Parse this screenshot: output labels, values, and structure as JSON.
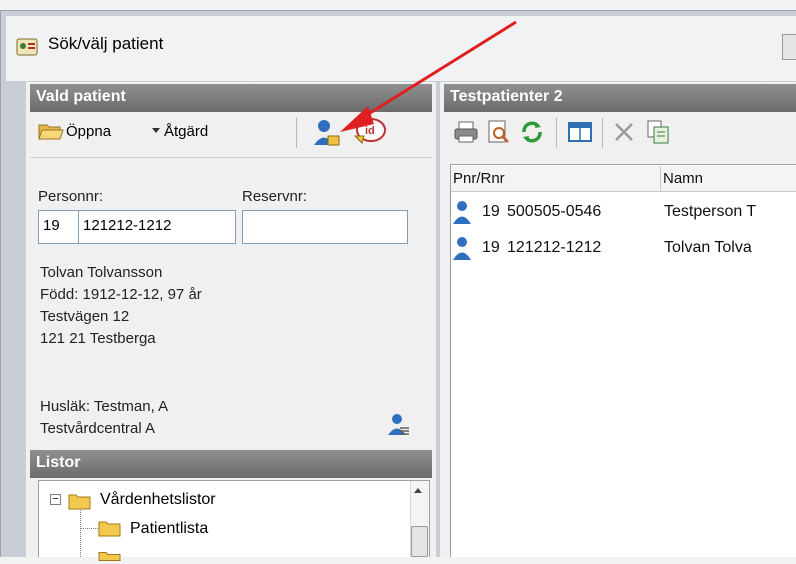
{
  "window": {
    "title": "Sök/välj patient"
  },
  "left_panel": {
    "header": "Vald patient",
    "toolbar": {
      "open_label": "Öppna",
      "action_label": "Åtgärd"
    },
    "personnr_label": "Personnr:",
    "reservnr_label": "Reservnr:",
    "personnr_prefix": "19",
    "personnr_value": "121212-1212",
    "reservnr_value": "",
    "patient_info": [
      "Tolvan Tolvansson",
      "Född: 1912-12-12, 97 år",
      "Testvägen 12",
      "121 21 Testberga"
    ],
    "gp_info": [
      "Husläk: Testman, A",
      "Testvårdcentral A"
    ]
  },
  "lists_panel": {
    "header": "Listor",
    "tree": [
      {
        "label": "Vårdenhetslistor"
      },
      {
        "label": "Patientlista"
      }
    ]
  },
  "right_panel": {
    "header": "Testpatienter 2",
    "columns": [
      "Pnr/Rnr",
      "Namn"
    ],
    "rows": [
      {
        "prefix": "19",
        "pnr": "500505-0546",
        "name": "Testperson T"
      },
      {
        "prefix": "19",
        "pnr": "121212-1212",
        "name": "Tolvan Tolva"
      }
    ]
  },
  "colors": {
    "section_header": "#7a7a7a",
    "annotation_arrow": "#e02020",
    "person_icon": "#2f6fc0"
  },
  "icons": [
    "app-icon",
    "open-folder-icon",
    "person-icon",
    "id-card-icon",
    "print-icon",
    "preview-icon",
    "refresh-icon",
    "columns-icon",
    "delete-icon",
    "copy-icon",
    "folder-icon"
  ]
}
